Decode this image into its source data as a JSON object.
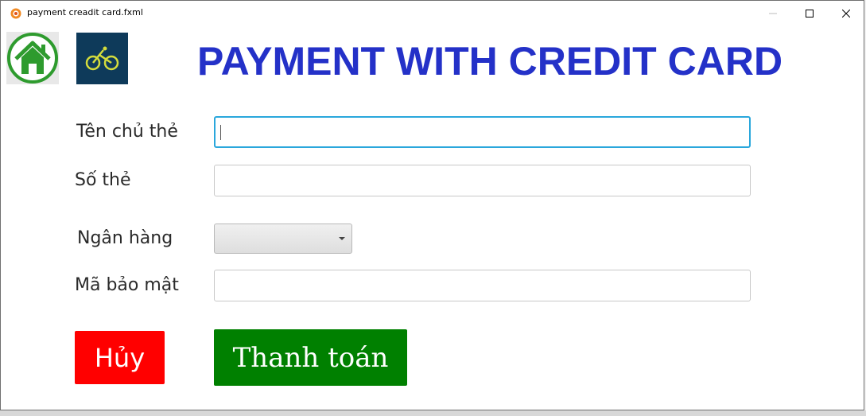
{
  "window": {
    "title": "payment creadit card.fxml"
  },
  "header": {
    "title": "PAYMENT WITH CREDIT CARD",
    "home_icon": "home-icon",
    "bike_icon": "bicycle-icon",
    "title_color": "#2431c8"
  },
  "form": {
    "cardholder": {
      "label": "Tên chủ thẻ",
      "value": ""
    },
    "card_number": {
      "label": "Số thẻ",
      "value": ""
    },
    "bank": {
      "label": "Ngân hàng",
      "selected": ""
    },
    "security_code": {
      "label": "Mã bảo mật",
      "value": ""
    }
  },
  "actions": {
    "cancel_label": "Hủy",
    "cancel_color": "#ff0000",
    "pay_label": "Thanh toán",
    "pay_color": "#008000"
  }
}
